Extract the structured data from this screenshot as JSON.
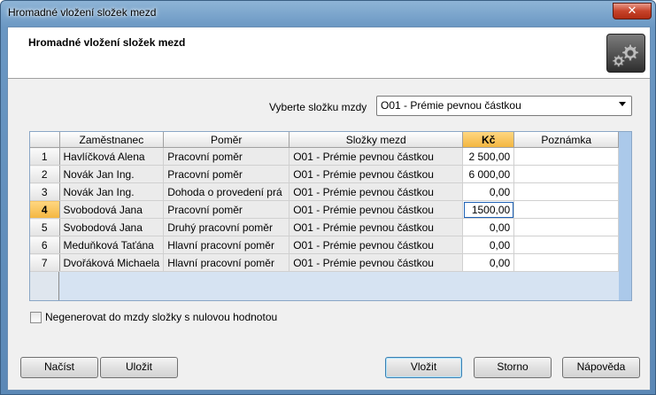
{
  "window": {
    "title": "Hromadné vložení složek mezd",
    "close_glyph": "✕"
  },
  "header": {
    "title": "Hromadné vložení složek mezd",
    "icon": "gear-icon"
  },
  "selector": {
    "label": "Vyberte složku mzdy",
    "value": "O01 - Prémie pevnou částkou"
  },
  "table": {
    "columns": [
      "Zaměstnanec",
      "Poměr",
      "Složky mezd",
      "Kč",
      "Poznámka"
    ],
    "active_row": 4,
    "rows": [
      {
        "num": "1",
        "employee": "Havlíčková Alena",
        "ratio": "Pracovní poměr",
        "component": "O01 - Prémie pevnou částkou",
        "amount": "2 500,00",
        "note": ""
      },
      {
        "num": "2",
        "employee": "Novák Jan Ing.",
        "ratio": "Pracovní poměr",
        "component": "O01 - Prémie pevnou částkou",
        "amount": "6 000,00",
        "note": ""
      },
      {
        "num": "3",
        "employee": "Novák Jan Ing.",
        "ratio": "Dohoda o provedení prá",
        "component": "O01 - Prémie pevnou částkou",
        "amount": "0,00",
        "note": ""
      },
      {
        "num": "4",
        "employee": "Svobodová Jana",
        "ratio": "Pracovní poměr",
        "component": "O01 - Prémie pevnou částkou",
        "amount": "1500,00",
        "note": ""
      },
      {
        "num": "5",
        "employee": "Svobodová Jana",
        "ratio": "Druhý pracovní poměr",
        "component": "O01 - Prémie pevnou částkou",
        "amount": "0,00",
        "note": ""
      },
      {
        "num": "6",
        "employee": "Meduňková Taťána",
        "ratio": "Hlavní pracovní poměr",
        "component": "O01 - Prémie pevnou částkou",
        "amount": "0,00",
        "note": ""
      },
      {
        "num": "7",
        "employee": "Dvořáková Michaela",
        "ratio": "Hlavní pracovní poměr",
        "component": "O01 - Prémie pevnou částkou",
        "amount": "0,00",
        "note": ""
      }
    ]
  },
  "options": {
    "skip_zero_label": "Negenerovat do mzdy složky s nulovou hodnotou",
    "skip_zero_checked": false
  },
  "buttons": {
    "load": "Načíst",
    "save": "Uložit",
    "insert": "Vložit",
    "cancel": "Storno",
    "help": "Nápověda"
  }
}
